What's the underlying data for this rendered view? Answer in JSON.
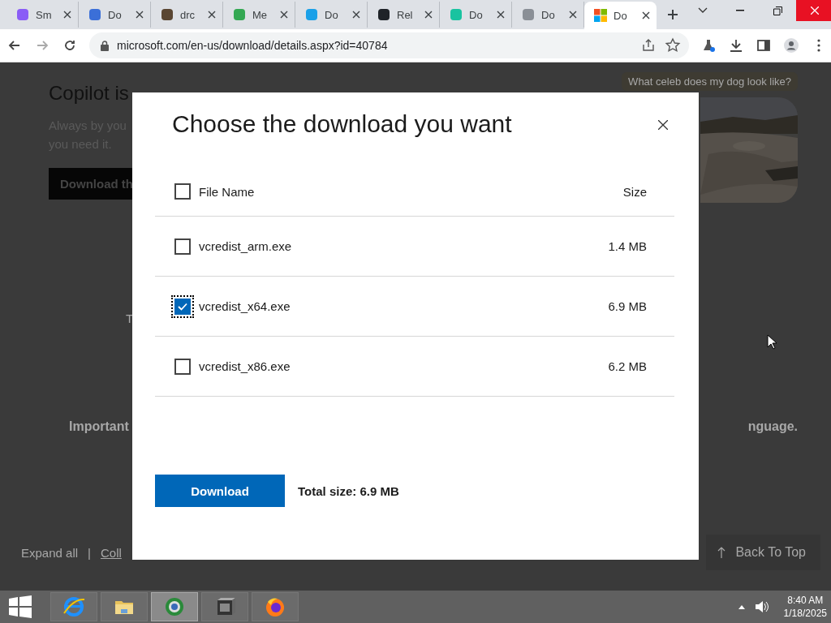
{
  "browser": {
    "tabs": [
      {
        "label": "Sm",
        "selected": false,
        "color": "#8a5cf6"
      },
      {
        "label": "Do",
        "selected": false,
        "color": "#3b6fd8"
      },
      {
        "label": "drc",
        "selected": false,
        "color": "#5a4632"
      },
      {
        "label": "Me",
        "selected": false,
        "color": "#34a853"
      },
      {
        "label": "Do",
        "selected": false,
        "color": "#1aa0e8"
      },
      {
        "label": "Rel",
        "selected": false,
        "color": "#1f2328"
      },
      {
        "label": "Do",
        "selected": false,
        "color": "#19c3a0"
      },
      {
        "label": "Do",
        "selected": false,
        "color": "#8a8f96"
      },
      {
        "label": "Do",
        "selected": true,
        "color": "#f25022"
      }
    ],
    "address": "microsoft.com/en-us/download/details.aspx?id=40784"
  },
  "page": {
    "heading": "Copilot is",
    "lines": [
      "Always by you",
      "you need it."
    ],
    "button": "Download th",
    "prompt": "What celeb does my dog look like?",
    "fragment": "T",
    "important": "Important",
    "important_end": "nguage.",
    "expand": "Expand all",
    "separator": "|",
    "collapse": "Coll",
    "back_to_top": "Back To Top"
  },
  "dialog": {
    "title": "Choose the download you want",
    "header": {
      "checked": false,
      "file_name": "File Name",
      "size": "Size"
    },
    "files": [
      {
        "name": "vcredist_arm.exe",
        "size": "1.4 MB",
        "checked": false,
        "focused": false
      },
      {
        "name": "vcredist_x64.exe",
        "size": "6.9 MB",
        "checked": true,
        "focused": true
      },
      {
        "name": "vcredist_x86.exe",
        "size": "6.2 MB",
        "checked": false,
        "focused": false
      }
    ],
    "button": "Download",
    "total": "Total size: 6.9 MB"
  },
  "taskbar": {
    "apps": [
      {
        "kind": "ie",
        "selected": false
      },
      {
        "kind": "folder",
        "selected": false
      },
      {
        "kind": "globe",
        "selected": true
      },
      {
        "kind": "archive",
        "selected": false
      },
      {
        "kind": "firefox",
        "selected": false
      }
    ],
    "time": "8:40 AM",
    "date": "1/18/2025"
  }
}
